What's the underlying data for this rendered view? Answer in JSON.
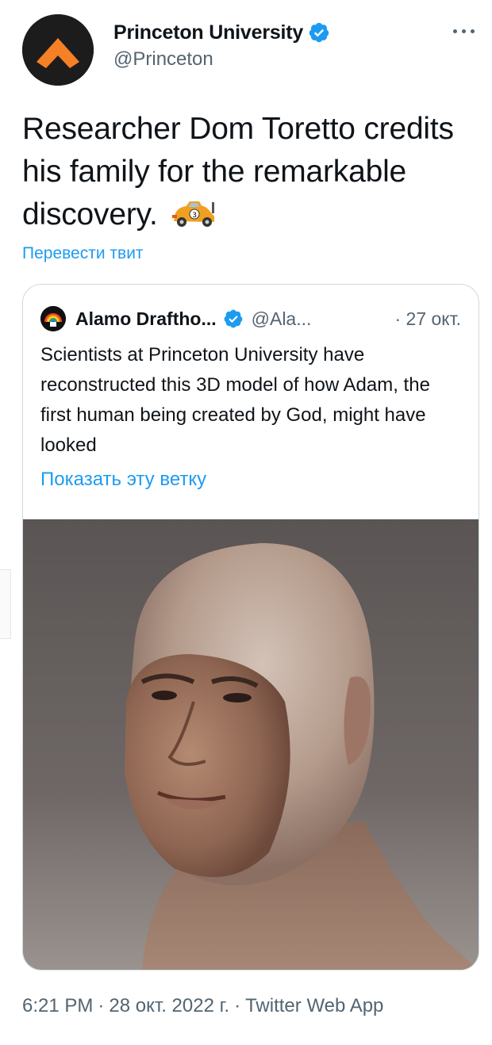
{
  "tweet": {
    "author": {
      "display_name": "Princeton University",
      "handle": "@Princeton",
      "verified": true,
      "avatar_icon": "princeton-chevron-logo"
    },
    "text": "Researcher Dom Toretto credits his family for the remarkable discovery.",
    "emoji_icon": "race-car-icon",
    "translate_label": "Перевести твит",
    "more_icon": "more-options-icon",
    "timestamp": "6:21 PM",
    "date": "28 окт. 2022 г.",
    "source": "Twitter Web App",
    "separator": "·"
  },
  "quote": {
    "author": {
      "display_name": "Alamo Draftho...",
      "handle": "@Ala...",
      "verified": true,
      "avatar_icon": "alamo-rainbow-logo"
    },
    "date": "· 27 окт.",
    "text": "Scientists at Princeton University have reconstructed this 3D model of how Adam, the first human being created by God, might have looked",
    "thread_link": "Показать эту ветку",
    "media_icon": "3d-head-render-image"
  },
  "colors": {
    "link": "#1d9bf0",
    "secondary_text": "#536471",
    "primary_text": "#0f1419",
    "border": "#cfd9de",
    "princeton_orange": "#f58025"
  }
}
